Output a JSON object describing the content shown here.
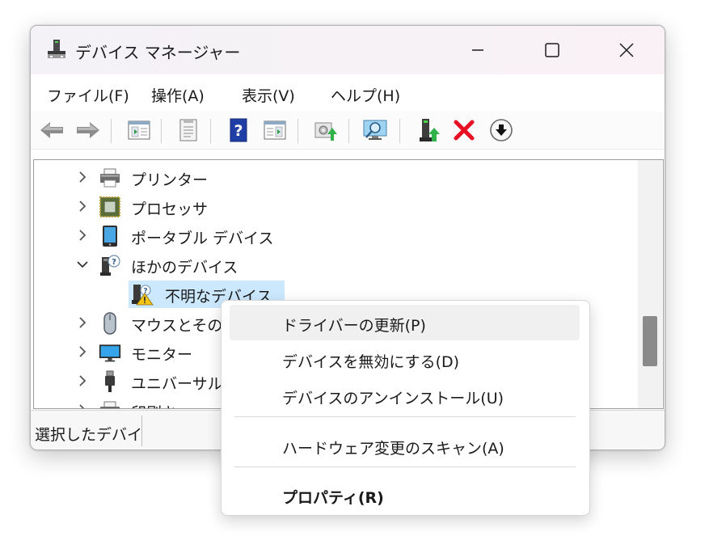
{
  "window": {
    "title": "デバイス マネージャー"
  },
  "menubar": {
    "items": [
      "ファイル(F)",
      "操作(A)",
      "表示(V)",
      "ヘルプ(H)"
    ]
  },
  "toolbar": {
    "buttons": [
      "back-arrow-icon",
      "forward-arrow-icon",
      "console-tree-icon",
      "properties-sheet-icon",
      "help-icon",
      "action-pane-icon",
      "update-driver-icon",
      "scan-hardware-icon",
      "enable-device-icon",
      "uninstall-device-icon",
      "download-driver-icon"
    ]
  },
  "tree": {
    "items": [
      {
        "label": "プリンター",
        "icon": "printer-icon",
        "expanded": false
      },
      {
        "label": "プロセッサ",
        "icon": "processor-icon",
        "expanded": false
      },
      {
        "label": "ポータブル デバイス",
        "icon": "portable-device-icon",
        "expanded": false
      },
      {
        "label": "ほかのデバイス",
        "icon": "other-devices-icon",
        "expanded": true
      },
      {
        "label": "不明なデバイス",
        "icon": "unknown-device-warning-icon",
        "selected": true
      },
      {
        "label": "マウスとその",
        "icon": "mouse-icon",
        "expanded": false
      },
      {
        "label": "モニター",
        "icon": "monitor-icon",
        "expanded": false
      },
      {
        "label": "ユニバーサル",
        "icon": "usb-icon",
        "expanded": false
      },
      {
        "label": "印刷キュー",
        "icon": "print-queue-icon",
        "expanded": false
      }
    ]
  },
  "statusbar": {
    "text": "選択したデバイ"
  },
  "context_menu": {
    "items": [
      {
        "label": "ドライバーの更新(P)",
        "highlighted": true
      },
      {
        "label": "デバイスを無効にする(D)"
      },
      {
        "label": "デバイスのアンインストール(U)"
      },
      {
        "label": "ハードウェア変更のスキャン(A)"
      },
      {
        "label": "プロパティ(R)",
        "bold": true
      }
    ]
  },
  "colors": {
    "selection": "#cce8ff",
    "menu_hover": "#f0f0f0",
    "uninstall_red": "#e81123",
    "help_blue": "#1f3fa6",
    "green_arrow": "#2fb24a"
  }
}
